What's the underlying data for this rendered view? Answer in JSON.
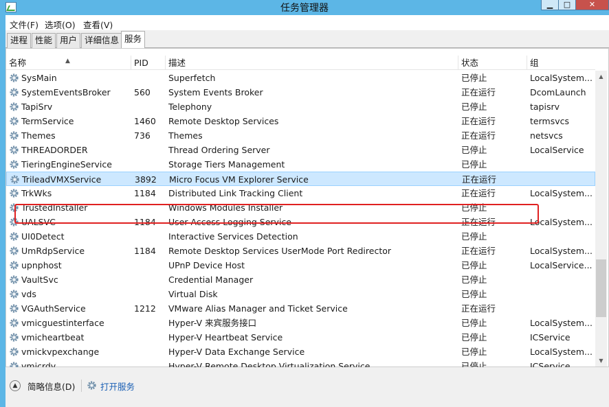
{
  "window": {
    "title": "任务管理器",
    "min_label": "▁",
    "max_label": "□",
    "close_label": "✕"
  },
  "menu": [
    "文件(F)",
    "选项(O)",
    "查看(V)"
  ],
  "tabs": [
    "进程",
    "性能",
    "用户",
    "详细信息",
    "服务"
  ],
  "active_tab": "服务",
  "columns": [
    "名称",
    "PID",
    "描述",
    "状态",
    "组"
  ],
  "rows": [
    {
      "name": "SysMain",
      "pid": "",
      "desc": "Superfetch",
      "status": "已停止",
      "group": "LocalSystem..."
    },
    {
      "name": "SystemEventsBroker",
      "pid": "560",
      "desc": "System Events Broker",
      "status": "正在运行",
      "group": "DcomLaunch"
    },
    {
      "name": "TapiSrv",
      "pid": "",
      "desc": "Telephony",
      "status": "已停止",
      "group": "tapisrv"
    },
    {
      "name": "TermService",
      "pid": "1460",
      "desc": "Remote Desktop Services",
      "status": "正在运行",
      "group": "termsvcs"
    },
    {
      "name": "Themes",
      "pid": "736",
      "desc": "Themes",
      "status": "正在运行",
      "group": "netsvcs"
    },
    {
      "name": "THREADORDER",
      "pid": "",
      "desc": "Thread Ordering Server",
      "status": "已停止",
      "group": "LocalService"
    },
    {
      "name": "TieringEngineService",
      "pid": "",
      "desc": "Storage Tiers Management",
      "status": "已停止",
      "group": ""
    },
    {
      "name": "TrileadVMXService",
      "pid": "3892",
      "desc": "Micro Focus VM Explorer Service",
      "status": "正在运行",
      "group": ""
    },
    {
      "name": "TrkWks",
      "pid": "1184",
      "desc": "Distributed Link Tracking Client",
      "status": "正在运行",
      "group": "LocalSystem..."
    },
    {
      "name": "TrustedInstaller",
      "pid": "",
      "desc": "Windows Modules Installer",
      "status": "已停止",
      "group": ""
    },
    {
      "name": "UALSVC",
      "pid": "1184",
      "desc": "User Access Logging Service",
      "status": "正在运行",
      "group": "LocalSystem..."
    },
    {
      "name": "UI0Detect",
      "pid": "",
      "desc": "Interactive Services Detection",
      "status": "已停止",
      "group": ""
    },
    {
      "name": "UmRdpService",
      "pid": "1184",
      "desc": "Remote Desktop Services UserMode Port Redirector",
      "status": "正在运行",
      "group": "LocalSystem..."
    },
    {
      "name": "upnphost",
      "pid": "",
      "desc": "UPnP Device Host",
      "status": "已停止",
      "group": "LocalService..."
    },
    {
      "name": "VaultSvc",
      "pid": "",
      "desc": "Credential Manager",
      "status": "已停止",
      "group": ""
    },
    {
      "name": "vds",
      "pid": "",
      "desc": "Virtual Disk",
      "status": "已停止",
      "group": ""
    },
    {
      "name": "VGAuthService",
      "pid": "1212",
      "desc": "VMware Alias Manager and Ticket Service",
      "status": "正在运行",
      "group": ""
    },
    {
      "name": "vmicguestinterface",
      "pid": "",
      "desc": "Hyper-V 来宾服务接口",
      "status": "已停止",
      "group": "LocalSystem..."
    },
    {
      "name": "vmicheartbeat",
      "pid": "",
      "desc": "Hyper-V Heartbeat Service",
      "status": "已停止",
      "group": "ICService"
    },
    {
      "name": "vmickvpexchange",
      "pid": "",
      "desc": "Hyper-V Data Exchange Service",
      "status": "已停止",
      "group": "LocalSystem..."
    },
    {
      "name": "vmicrdv",
      "pid": "",
      "desc": "Hyper-V Remote Desktop Virtualization Service",
      "status": "已停止",
      "group": "ICService"
    }
  ],
  "selected_row": "TrileadVMXService",
  "footer": {
    "fewer_details": "简略信息(D)",
    "open_services": "打开服务"
  },
  "colors": {
    "title_bar": "#5cb6e6",
    "selection": "#cde8ff",
    "highlight_box": "#e02020",
    "link": "#1a5fb4"
  }
}
